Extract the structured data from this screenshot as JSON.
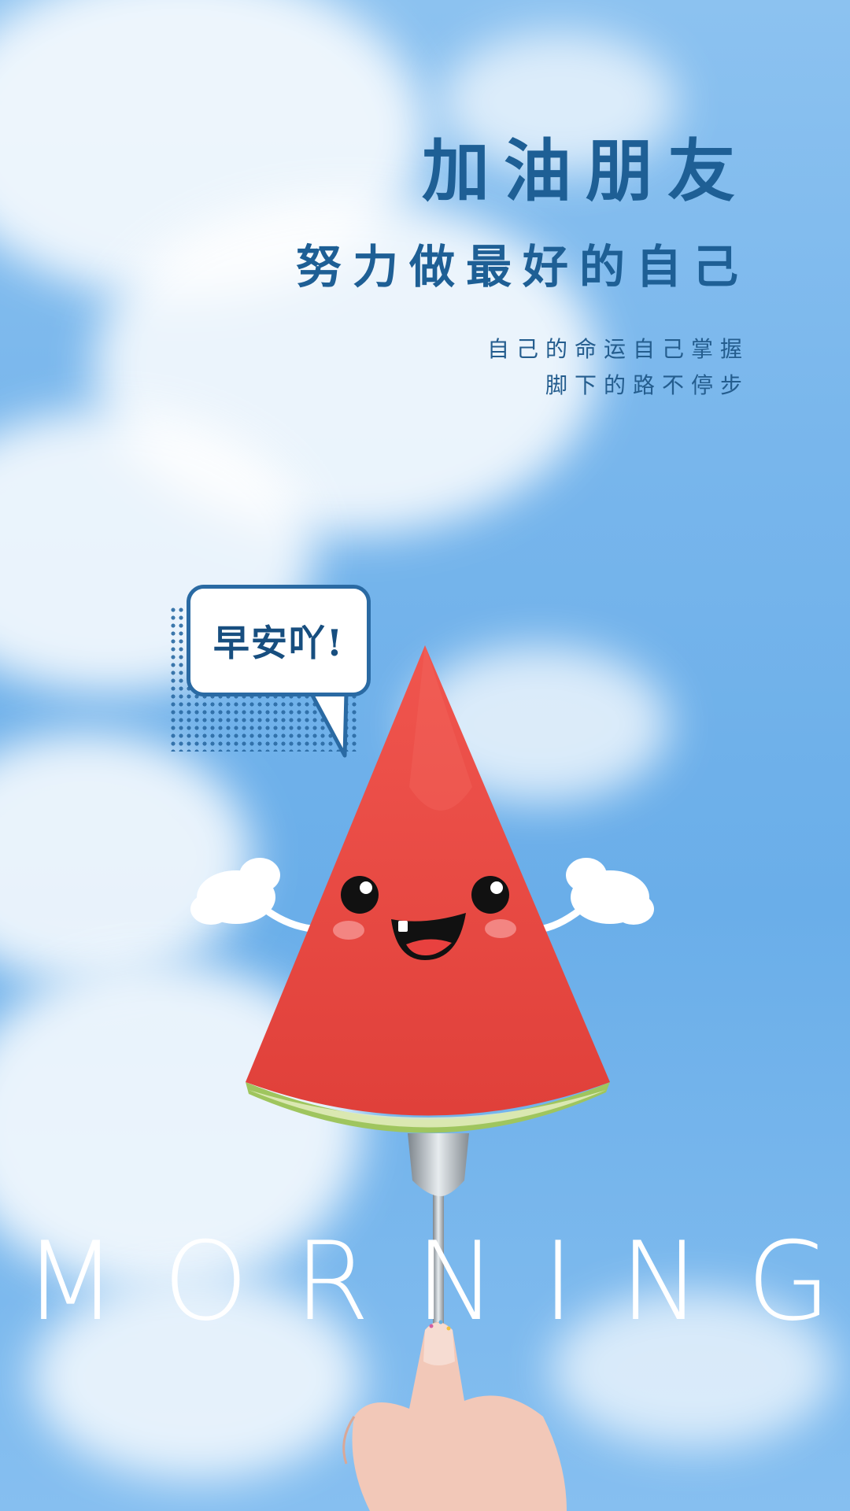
{
  "poster": {
    "title": "加油朋友",
    "subtitle": "努力做最好的自己",
    "line1": "自己的命运自己掌握",
    "line2": "脚下的路不停步",
    "bubble_text": "早安吖!",
    "bottom_word": "MORNING"
  },
  "colors": {
    "sky": "#78b6ec",
    "text_blue": "#1e5f95",
    "watermelon": "#e8413f",
    "rind": "#a6c96a"
  }
}
